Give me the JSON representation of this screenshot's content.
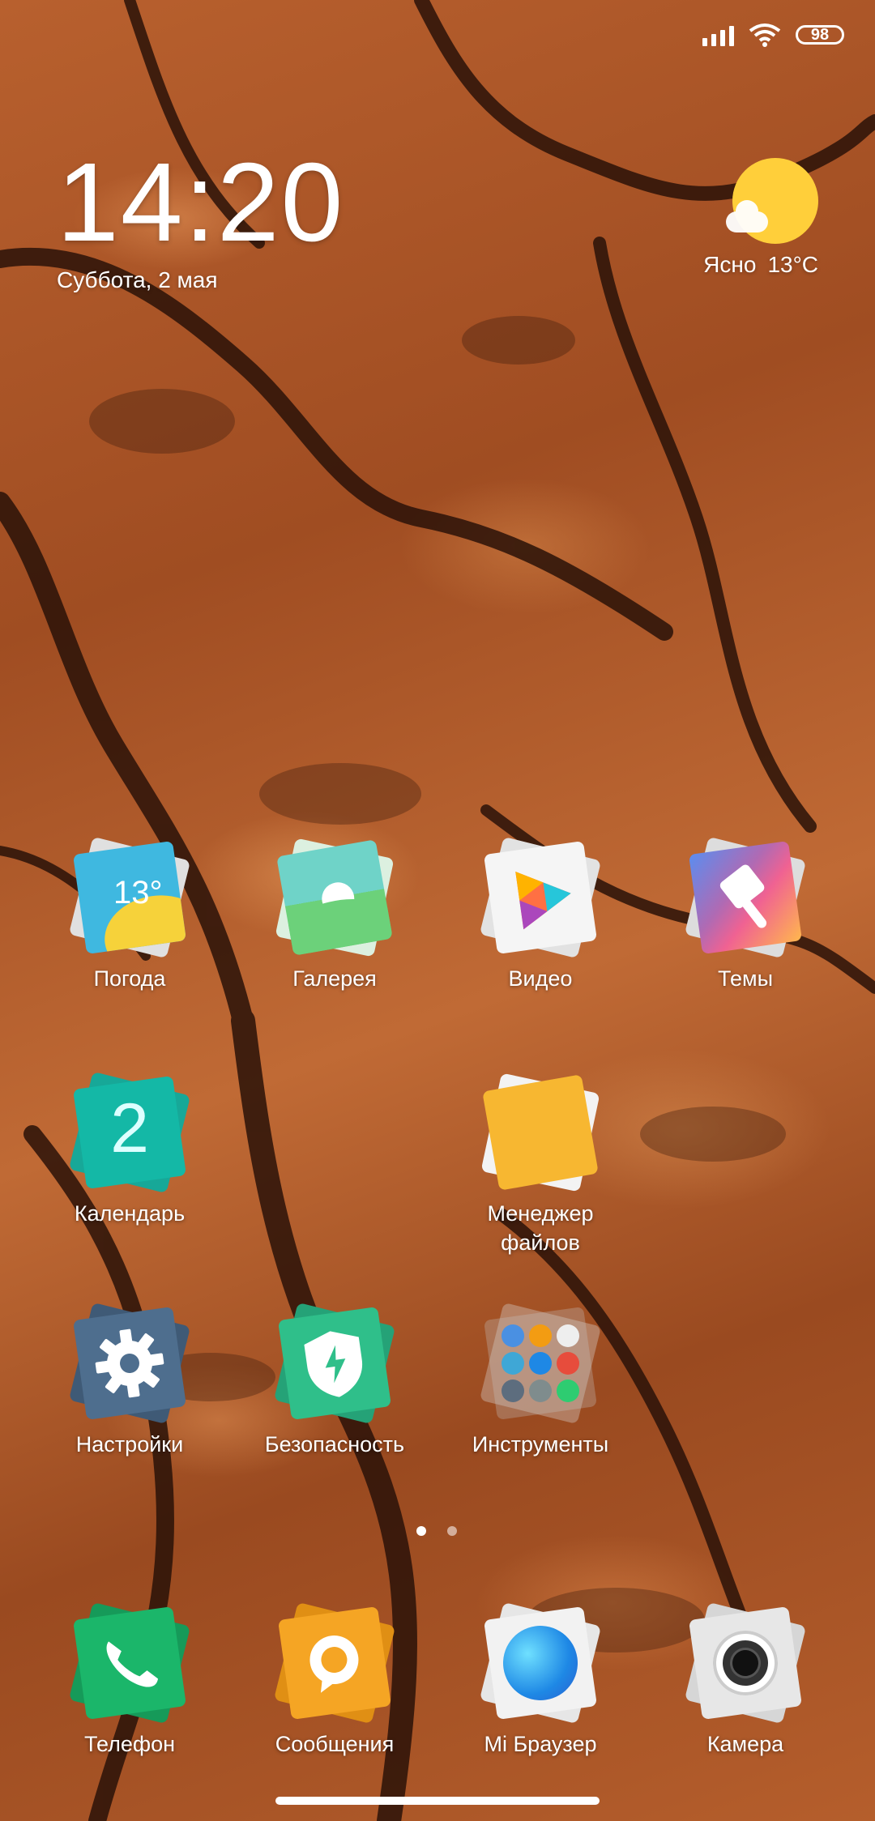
{
  "status_bar": {
    "battery": "98"
  },
  "clock": {
    "time": "14:20",
    "date": "Суббота, 2 мая"
  },
  "weather_widget": {
    "condition": "Ясно",
    "temperature": "13°C"
  },
  "apps_row1": [
    {
      "label": "Погода",
      "icon": "weather-icon",
      "badge": "13°"
    },
    {
      "label": "Галерея",
      "icon": "gallery-icon"
    },
    {
      "label": "Видео",
      "icon": "video-icon"
    },
    {
      "label": "Темы",
      "icon": "themes-icon"
    }
  ],
  "apps_row2": [
    {
      "label": "Календарь",
      "icon": "calendar-icon",
      "badge": "2"
    },
    {
      "label": "Менеджер файлов",
      "icon": "folder-icon"
    }
  ],
  "apps_row3": [
    {
      "label": "Настройки",
      "icon": "gear-icon"
    },
    {
      "label": "Безопасность",
      "icon": "shield-icon"
    },
    {
      "label": "Инструменты",
      "icon": "tools-folder-icon"
    }
  ],
  "dock": [
    {
      "label": "Телефон",
      "icon": "phone-icon"
    },
    {
      "label": "Сообщения",
      "icon": "messages-icon"
    },
    {
      "label": "Mi Браузер",
      "icon": "browser-icon"
    },
    {
      "label": "Камера",
      "icon": "camera-icon"
    }
  ],
  "page_indicator": {
    "pages": 2,
    "current": 1
  },
  "colors": {
    "weather": "#3fb8e0",
    "gallery": "#6cd17a",
    "calendar": "#14b8a6",
    "files": "#f7b731",
    "settings": "#4e6e8e",
    "security": "#2fbf8a",
    "phone": "#1bb66a",
    "messages": "#f5a524",
    "browser": "#1e88e5",
    "camera": "#e7e7e7"
  }
}
